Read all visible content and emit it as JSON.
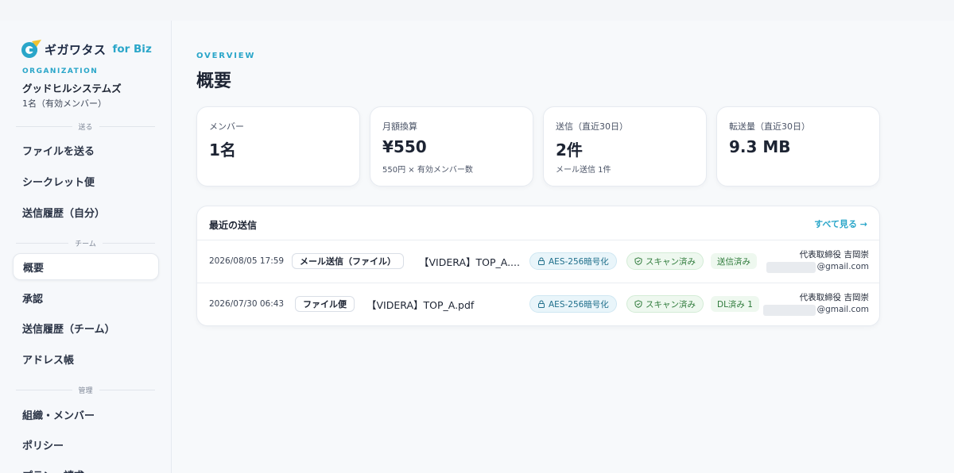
{
  "brand": {
    "name": "ギガワタス",
    "suffix": "for Biz"
  },
  "organization": {
    "label": "ORGANIZATION",
    "name": "グッドヒルシステムズ",
    "members": "1名（有効メンバー）"
  },
  "sidebar": {
    "sections": [
      {
        "label": "送る",
        "items": [
          "ファイルを送る",
          "シークレット便",
          "送信履歴（自分）"
        ]
      },
      {
        "label": "チーム",
        "items": [
          "概要",
          "承認",
          "送信履歴（チーム）",
          "アドレス帳"
        ]
      },
      {
        "label": "管理",
        "items": [
          "組織・メンバー",
          "ポリシー",
          "プラン・請求"
        ]
      }
    ],
    "active_item": "概要"
  },
  "page": {
    "eyebrow": "OVERVIEW",
    "title": "概要"
  },
  "stats": [
    {
      "label": "メンバー",
      "value": "1名",
      "sub": ""
    },
    {
      "label": "月額換算",
      "value": "¥550",
      "sub": "550円 × 有効メンバー数"
    },
    {
      "label": "送信（直近30日）",
      "value": "2件",
      "sub": "メール送信 1件"
    },
    {
      "label": "転送量（直近30日）",
      "value": "9.3 MB",
      "sub": ""
    }
  ],
  "recent": {
    "title": "最近の送信",
    "see_all": "すべて見る →",
    "rows": [
      {
        "date": "2026/08/05 17:59",
        "type": "メール送信（ファイル）",
        "file": "【VIDERA】TOP_A....",
        "encryption": "AES-256暗号化",
        "scan": "スキャン済み",
        "status": "送信済み",
        "recipient_name": "代表取締役 吉岡崇",
        "recipient_email": "@gmail.com"
      },
      {
        "date": "2026/07/30 06:43",
        "type": "ファイル便",
        "file": "【VIDERA】TOP_A.pdf",
        "encryption": "AES-256暗号化",
        "scan": "スキャン済み",
        "status": "DL済み 1",
        "recipient_name": "代表取締役 吉岡崇",
        "recipient_email": "@gmail.com"
      }
    ]
  },
  "colors": {
    "accent": "#2aa6c9",
    "text": "#1d2433",
    "success": "#2e7a3a"
  }
}
